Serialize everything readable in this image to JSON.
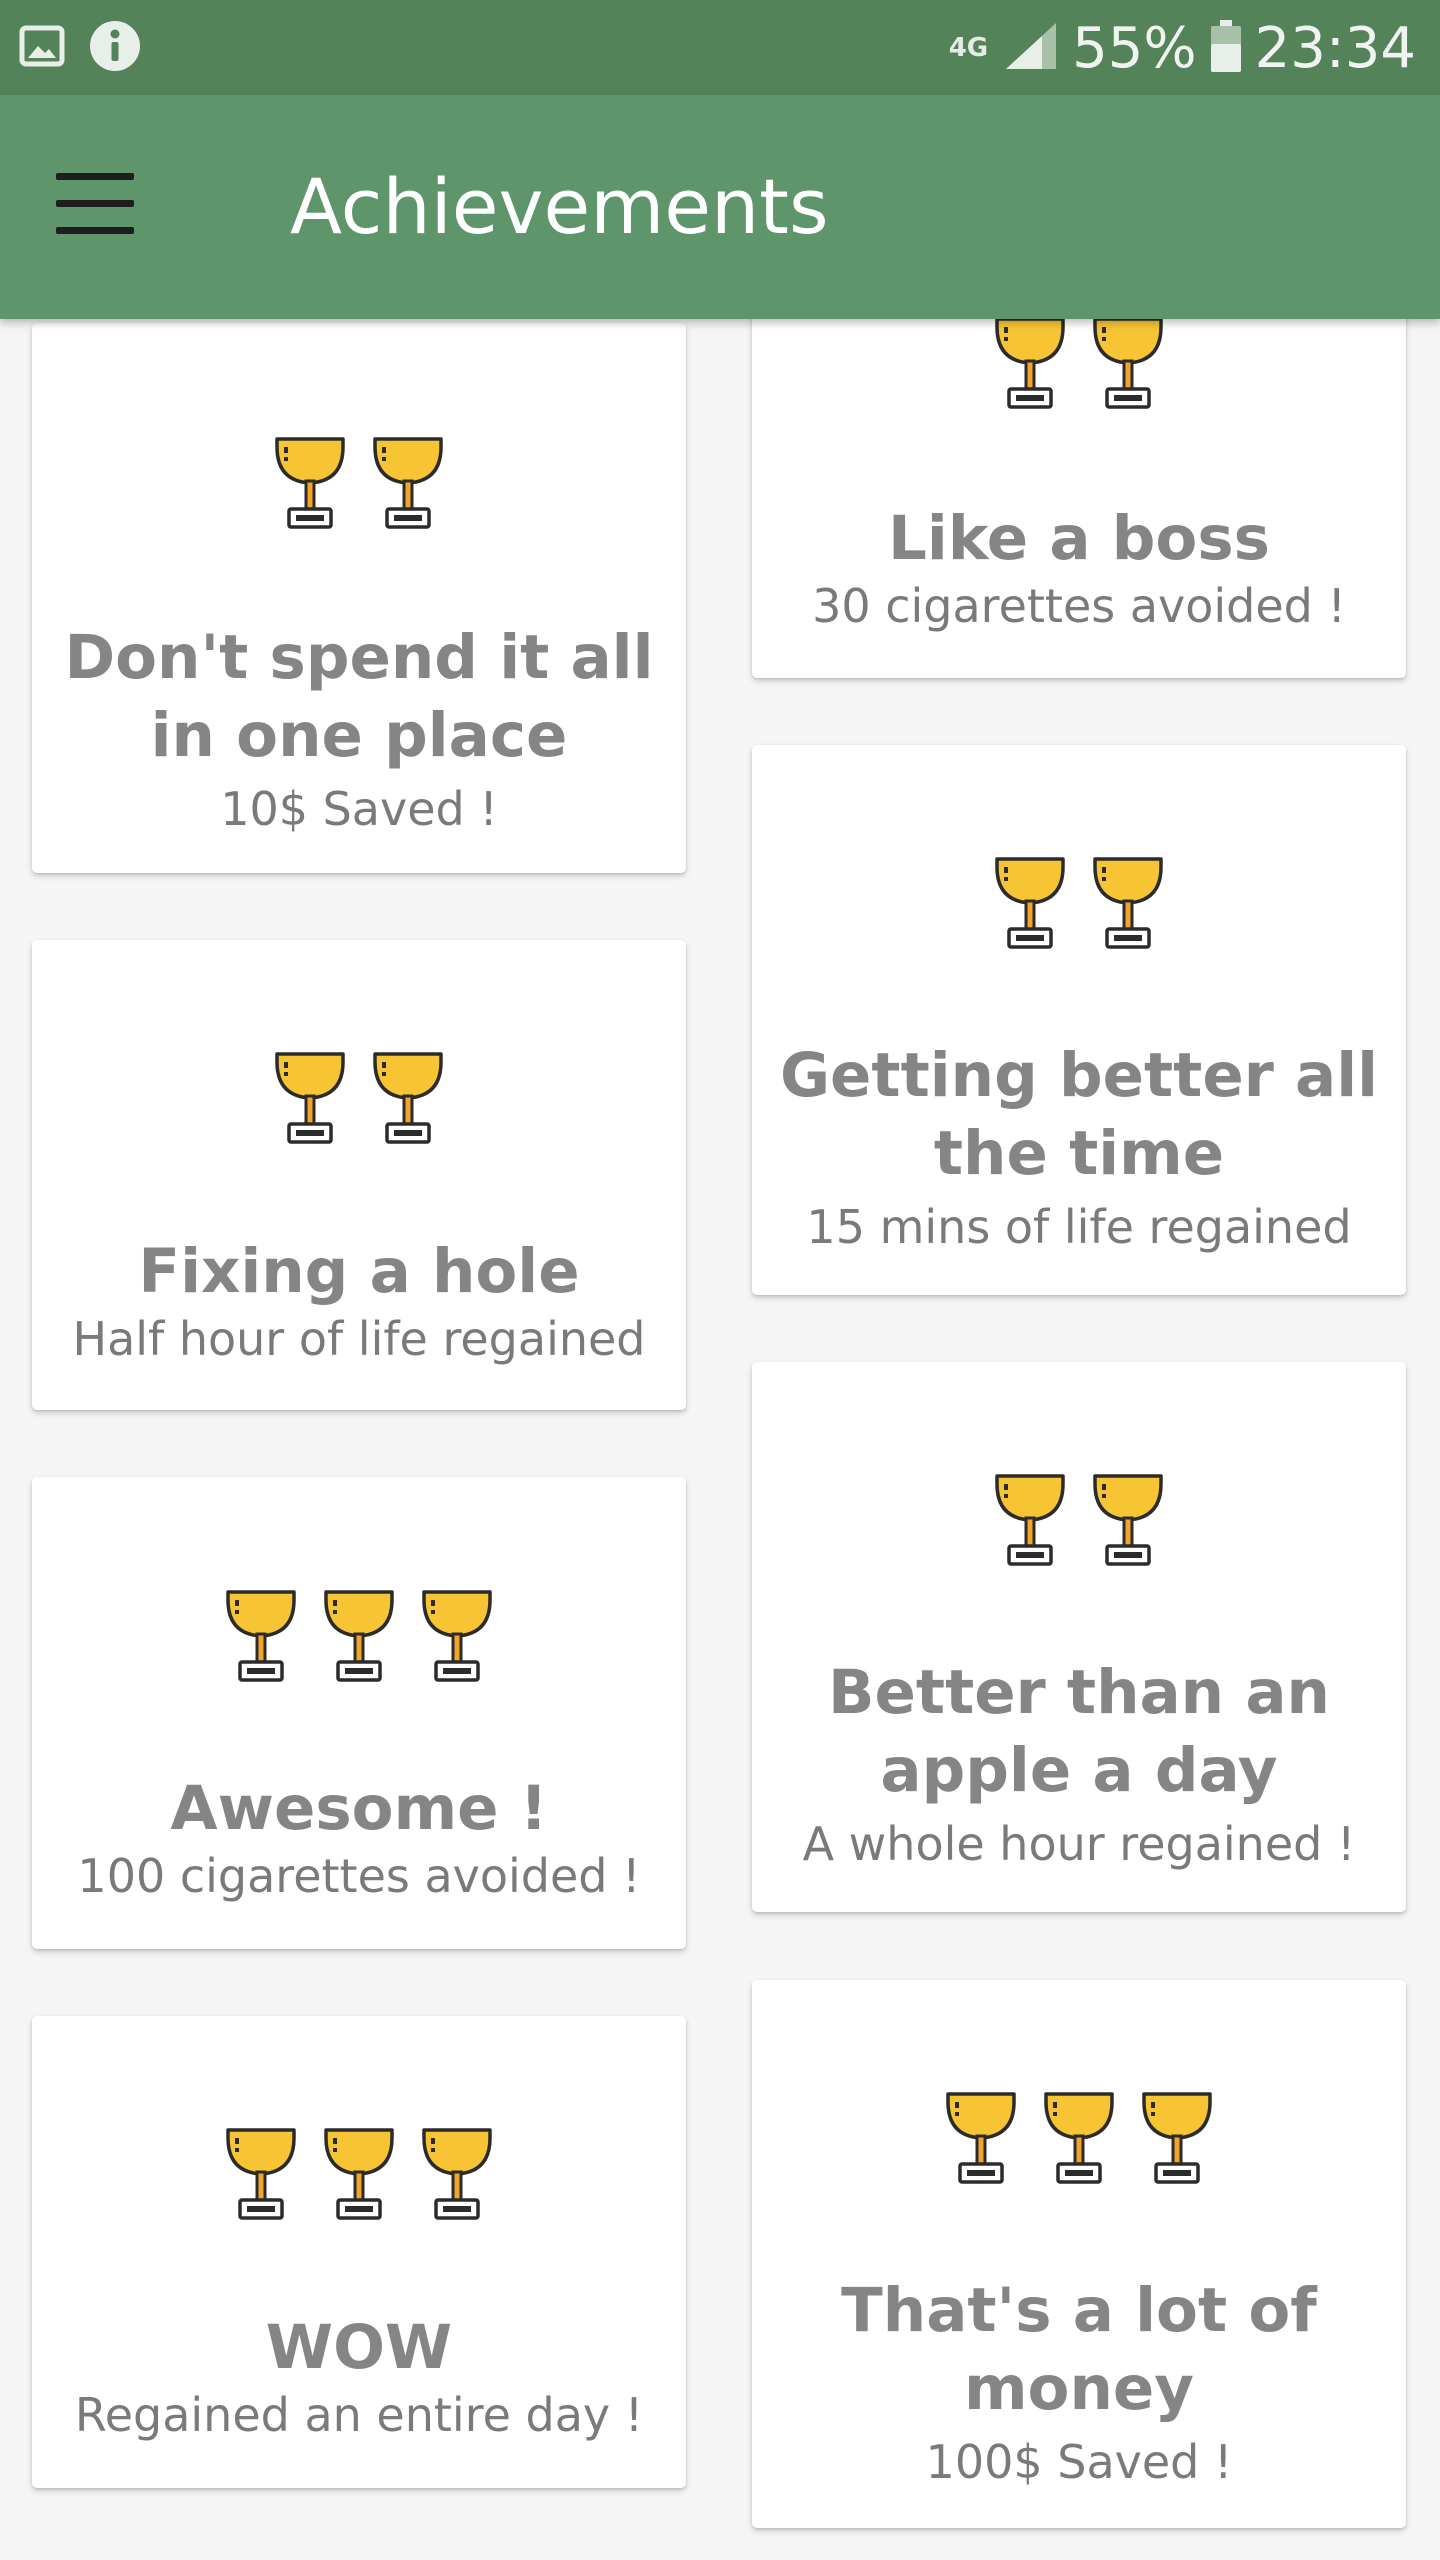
{
  "status_bar": {
    "network": "4G",
    "battery": "55%",
    "time": "23:34",
    "icons": [
      "image-icon",
      "info-icon",
      "signal-icon",
      "battery-icon"
    ]
  },
  "app_bar": {
    "title": "Achievements",
    "menu_icon": "hamburger-menu-icon",
    "color": "#5e956a"
  },
  "colors": {
    "status_bar": "#558359",
    "trophy_gold": "#f7c433",
    "trophy_stem": "#f2a529",
    "text": "#858585"
  },
  "achievements": [
    {
      "title": "Don't spend it all in one place",
      "subtitle": "10$ Saved !",
      "trophies": 2
    },
    {
      "title": "Like a boss",
      "subtitle": "30 cigarettes avoided !",
      "trophies": 2
    },
    {
      "title": "Getting better all the time",
      "subtitle": "15 mins of life regained",
      "trophies": 2
    },
    {
      "title": "Fixing a hole",
      "subtitle": "Half hour of life regained",
      "trophies": 2
    },
    {
      "title": "Better than an apple a day",
      "subtitle": "A whole hour regained !",
      "trophies": 2
    },
    {
      "title": "Awesome !",
      "subtitle": "100 cigarettes avoided !",
      "trophies": 3
    },
    {
      "title": "That's a lot of money",
      "subtitle": "100$ Saved !",
      "trophies": 3
    },
    {
      "title": "WOW",
      "subtitle": "Regained an entire day !",
      "trophies": 3
    }
  ]
}
